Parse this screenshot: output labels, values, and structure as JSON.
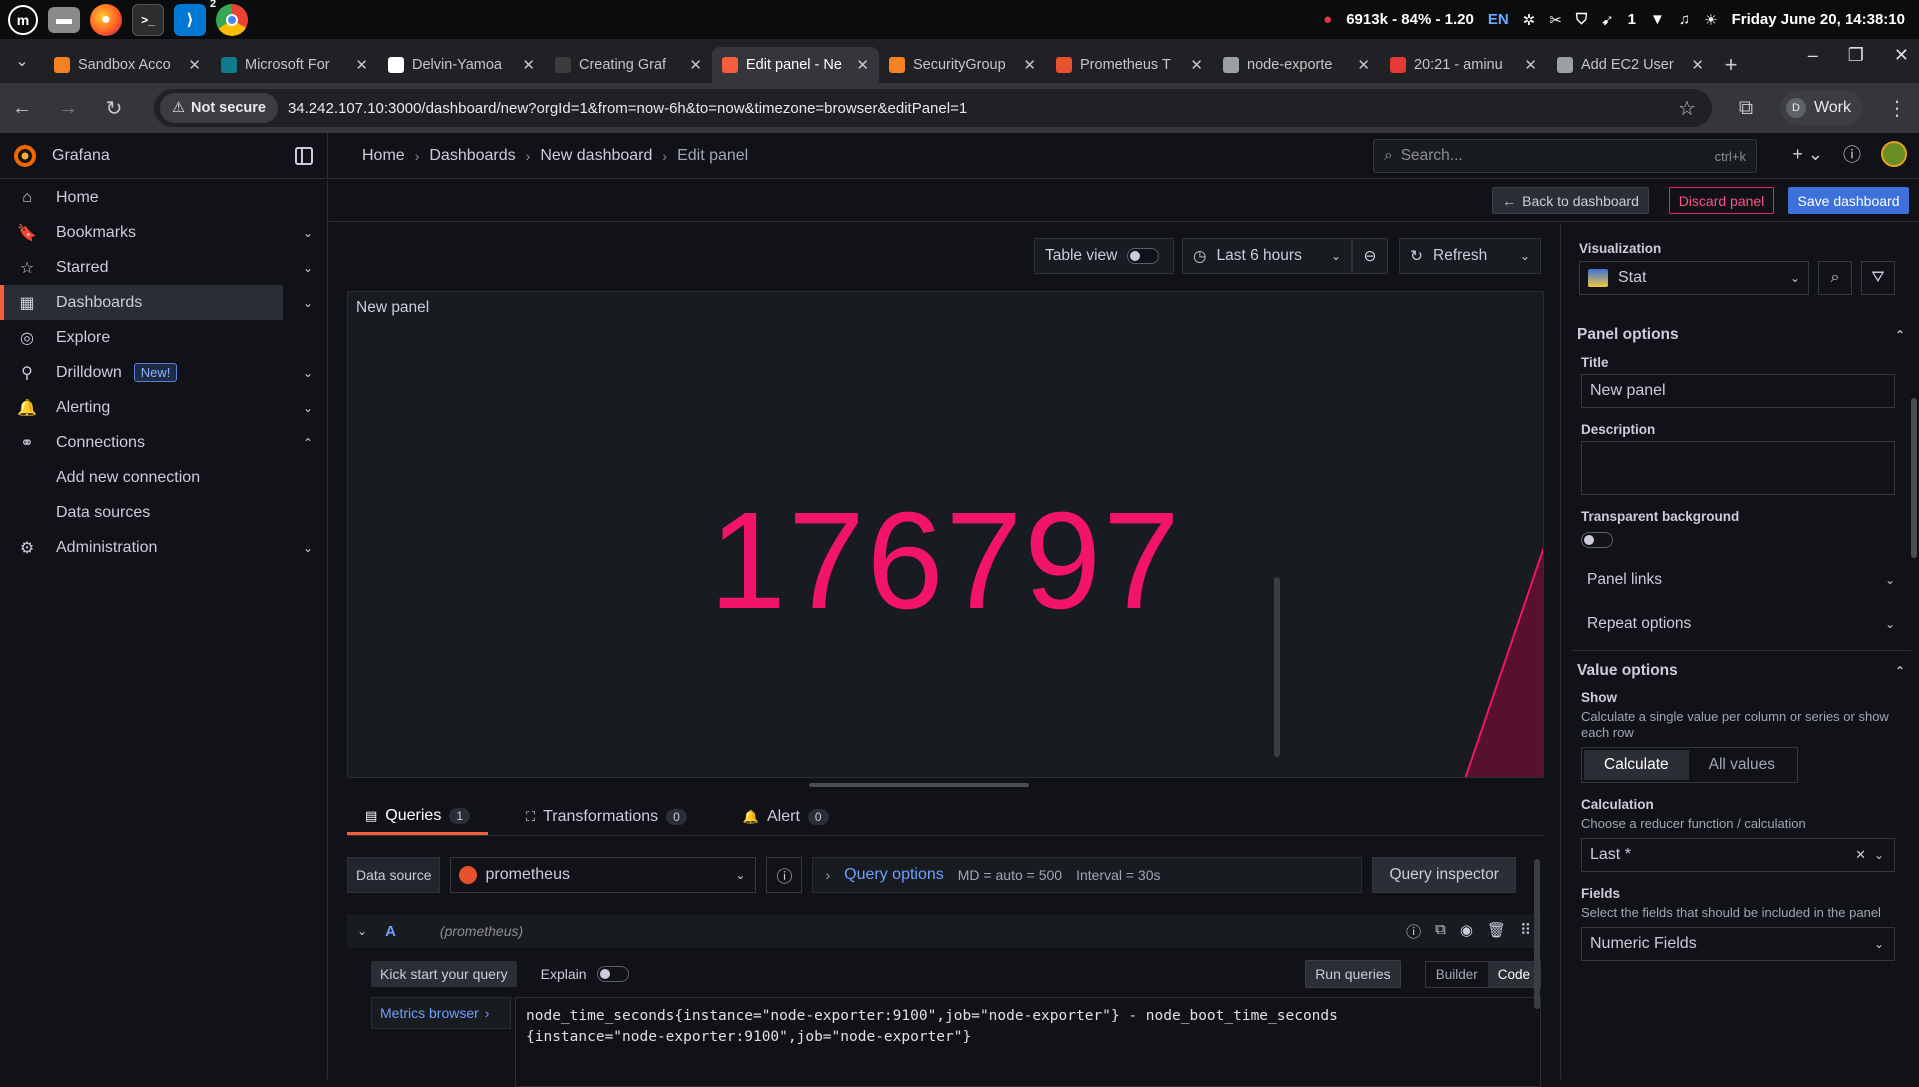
{
  "system": {
    "status": "6913k - 84% - 1.20",
    "lang": "EN",
    "notif": "1",
    "clock": "Friday June 20, 14:38:10",
    "workspace_badge": "2"
  },
  "browser": {
    "tabs": [
      {
        "title": "Sandbox Acco",
        "color": "#f58220"
      },
      {
        "title": "Microsoft For",
        "color": "#0f7b8c"
      },
      {
        "title": "Delvin-Yamoa",
        "color": "#ffffff"
      },
      {
        "title": "Creating Graf",
        "color": "#3b3b3b"
      },
      {
        "title": "Edit panel - Ne",
        "color": "#f55f3e"
      },
      {
        "title": "SecurityGroup",
        "color": "#f58220"
      },
      {
        "title": "Prometheus T",
        "color": "#e6522c"
      },
      {
        "title": "node-exporte",
        "color": "#9aa0a6"
      },
      {
        "title": "20:21 - aminu",
        "color": "#e53935"
      },
      {
        "title": "Add EC2 User",
        "color": "#9aa0a6"
      }
    ],
    "not_secure": "Not secure",
    "url": "34.242.107.10:3000/dashboard/new?orgId=1&from=now-6h&to=now&timezone=browser&editPanel=1",
    "profile": "Work",
    "profile_initial": "D"
  },
  "grafana": {
    "brand": "Grafana",
    "breadcrumb": [
      "Home",
      "Dashboards",
      "New dashboard",
      "Edit panel"
    ],
    "search_placeholder": "Search...",
    "search_shortcut": "ctrl+k",
    "sidebar": [
      {
        "label": "Home",
        "chev": ""
      },
      {
        "label": "Bookmarks",
        "chev": "v"
      },
      {
        "label": "Starred",
        "chev": "v"
      },
      {
        "label": "Dashboards",
        "chev": "v"
      },
      {
        "label": "Explore",
        "chev": ""
      },
      {
        "label": "Drilldown",
        "chev": "v",
        "badge": "New!"
      },
      {
        "label": "Alerting",
        "chev": "v"
      },
      {
        "label": "Connections",
        "chev": "^"
      },
      {
        "label": "Add new connection"
      },
      {
        "label": "Data sources"
      },
      {
        "label": "Administration",
        "chev": "v"
      }
    ],
    "actions": {
      "back": "Back to dashboard",
      "discard": "Discard panel",
      "save": "Save dashboard"
    },
    "panel_toolbar": {
      "table_view": "Table view",
      "time_range": "Last 6 hours",
      "refresh": "Refresh"
    },
    "panel": {
      "title": "New panel",
      "value": "176797"
    },
    "query_tabs": [
      {
        "label": "Queries",
        "count": "1"
      },
      {
        "label": "Transformations",
        "count": "0"
      },
      {
        "label": "Alert",
        "count": "0"
      }
    ],
    "query": {
      "datasource_label": "Data source",
      "datasource": "prometheus",
      "query_options": "Query options",
      "md": "MD = auto = 500",
      "interval": "Interval = 30s",
      "inspector": "Query inspector",
      "ref": "A",
      "ref_ds": "(prometheus)",
      "kickstart": "Kick start your query",
      "explain": "Explain",
      "run": "Run queries",
      "builder": "Builder",
      "code": "Code",
      "metrics_browser": "Metrics browser",
      "expr_line1": "node_time_seconds{instance=\"node-exporter:9100\",job=\"node-exporter\"} - node_boot_time_seconds",
      "expr_line2": "{instance=\"node-exporter:9100\",job=\"node-exporter\"}"
    },
    "options": {
      "viz_label": "Visualization",
      "viz": "Stat",
      "panel_options": "Panel options",
      "title_label": "Title",
      "title_value": "New panel",
      "desc_label": "Description",
      "transparent_label": "Transparent background",
      "panel_links": "Panel links",
      "repeat_options": "Repeat options",
      "value_options": "Value options",
      "show_label": "Show",
      "show_desc": "Calculate a single value per column or series or show each row",
      "show_calc": "Calculate",
      "show_all": "All values",
      "calc_label": "Calculation",
      "calc_desc": "Choose a reducer function / calculation",
      "calc_value": "Last *",
      "fields_label": "Fields",
      "fields_desc": "Select the fields that should be included in the panel",
      "fields_value": "Numeric Fields"
    }
  }
}
